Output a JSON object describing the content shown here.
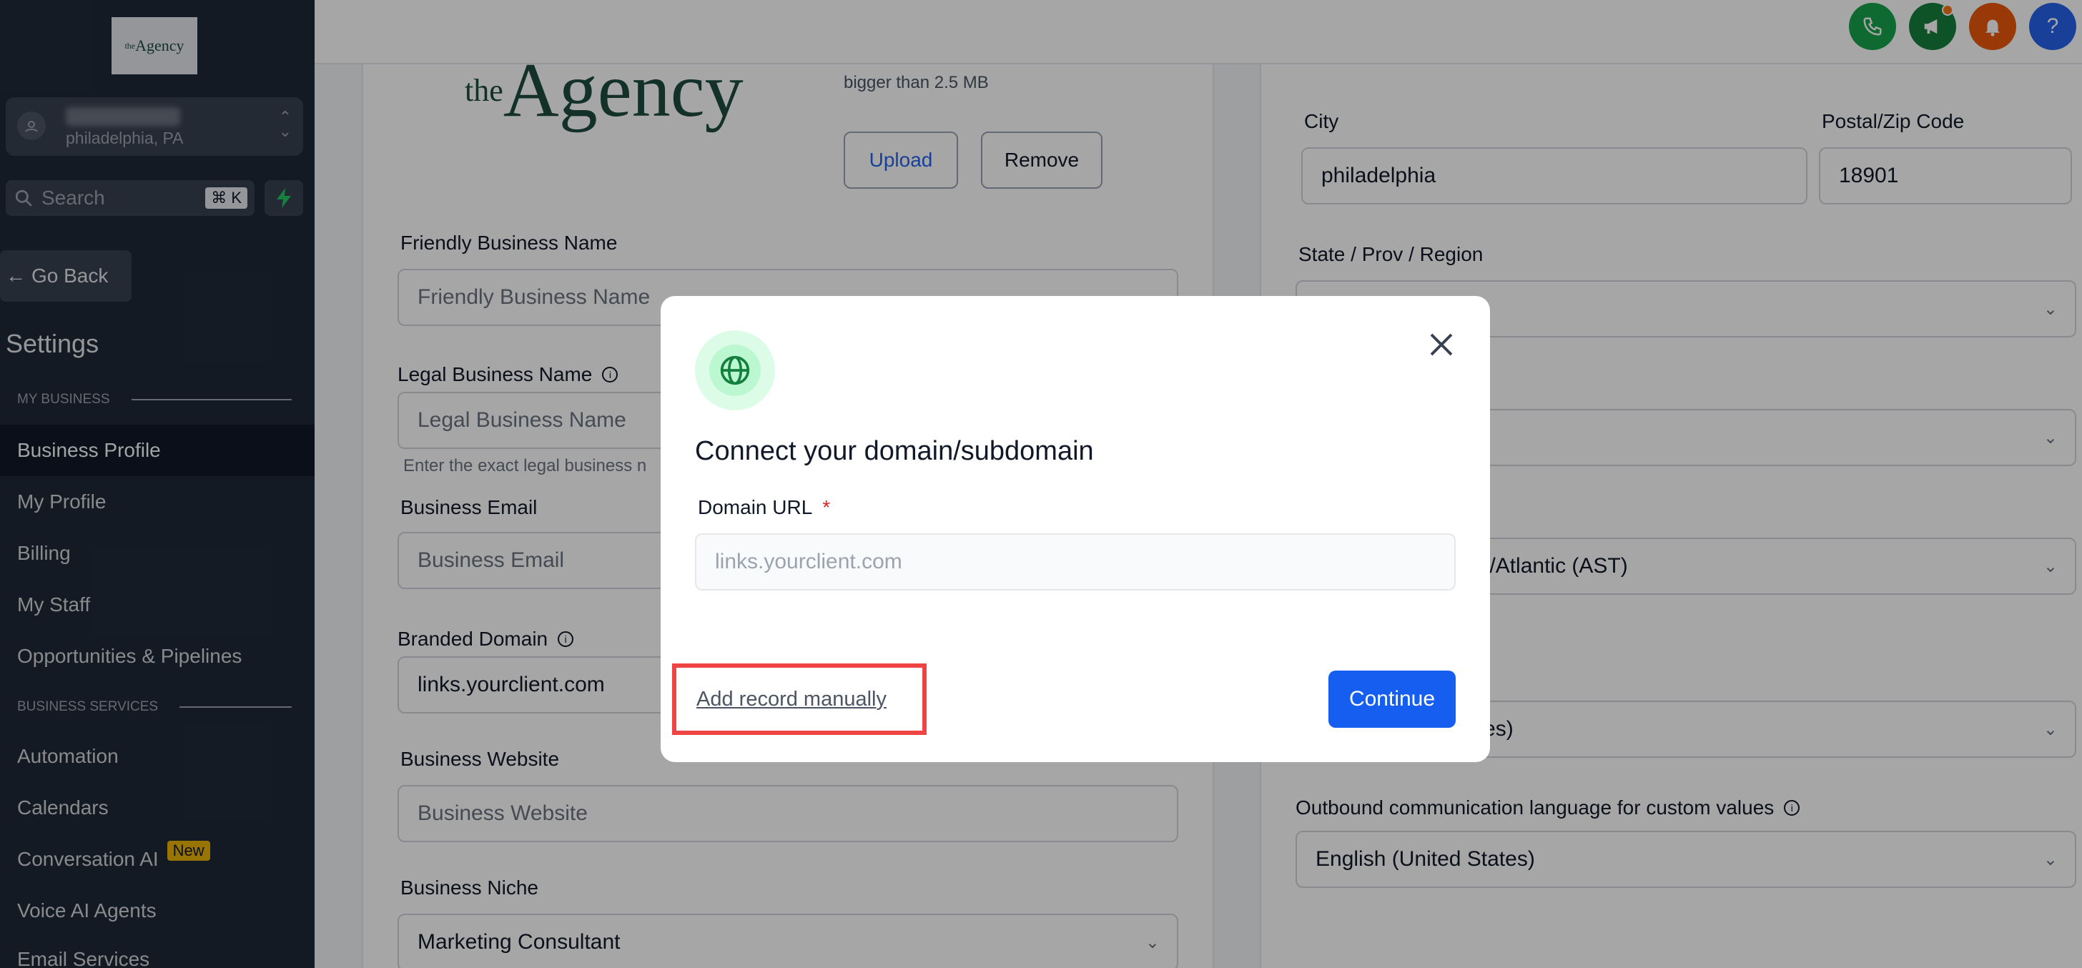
{
  "sidebar": {
    "logo_text": "Agency",
    "logo_sup": "the",
    "account_location": "philadelphia, PA",
    "search_placeholder": "Search",
    "search_shortcut": "⌘ K",
    "go_back": "Go Back",
    "settings_title": "Settings",
    "section_my_business": "MY BUSINESS",
    "section_business_services": "BUSINESS SERVICES",
    "items": [
      {
        "label": "Business Profile"
      },
      {
        "label": "My Profile"
      },
      {
        "label": "Billing"
      },
      {
        "label": "My Staff"
      },
      {
        "label": "Opportunities & Pipelines"
      },
      {
        "label": "Automation"
      },
      {
        "label": "Calendars"
      },
      {
        "label": "Conversation AI"
      },
      {
        "label": "Voice AI Agents"
      },
      {
        "label": "Email Services"
      }
    ],
    "new_badge": "New"
  },
  "topbar": {
    "icons": [
      "phone-icon",
      "megaphone-icon",
      "bell-icon",
      "help-icon"
    ],
    "colors": [
      "#16a34a",
      "#15803d",
      "#ea580c",
      "#2563eb"
    ],
    "help_glyph": "?"
  },
  "profile": {
    "logo_the": "the",
    "logo_word": "Agency",
    "upload_note": "bigger than 2.5 MB",
    "upload_label": "Upload",
    "remove_label": "Remove",
    "friendly_name_label": "Friendly Business Name",
    "friendly_name_placeholder": "Friendly Business Name",
    "legal_name_label": "Legal Business Name",
    "legal_name_placeholder": "Legal Business Name",
    "legal_name_help": "Enter the exact legal business n",
    "email_label": "Business Email",
    "email_placeholder": "Business Email",
    "branded_domain_label": "Branded Domain",
    "branded_domain_value": "links.yourclient.com",
    "website_label": "Business Website",
    "website_placeholder": "Business Website",
    "niche_label": "Business Niche",
    "niche_value": "Marketing Consultant"
  },
  "address": {
    "city_label": "City",
    "city_value": "philadelphia",
    "zip_label": "Postal/Zip Code",
    "zip_value": "18901",
    "state_label": "State / Prov / Region",
    "timezone_value": "da/Atlantic (AST)",
    "language_partial": "ates)",
    "outbound_label": "Outbound communication language for custom values",
    "outbound_value": "English (United States)"
  },
  "modal": {
    "title": "Connect your domain/subdomain",
    "domain_label": "Domain URL",
    "required_mark": "*",
    "domain_placeholder": "links.yourclient.com",
    "manual_link": "Add record manually",
    "continue_label": "Continue"
  }
}
